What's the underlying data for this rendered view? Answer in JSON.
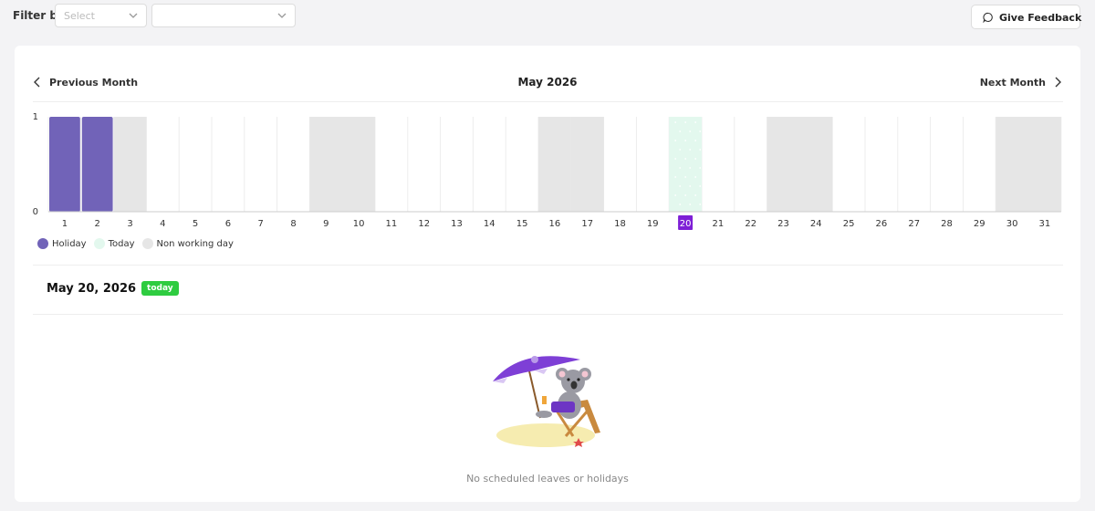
{
  "filter": {
    "label": "Filter by",
    "select1_placeholder": "Select",
    "select2_value": ""
  },
  "feedback": {
    "label": "Give Feedback",
    "icon": "chat-bubble-icon"
  },
  "nav": {
    "prev_label": "Previous Month",
    "next_label": "Next Month",
    "month_title": "May 2026"
  },
  "legend": [
    {
      "label": "Holiday",
      "color": "#7163b8"
    },
    {
      "label": "Today",
      "color": "#e3f8ee"
    },
    {
      "label": "Non working day",
      "color": "#e6e6e6"
    }
  ],
  "chart_data": {
    "type": "bar",
    "categories": [
      "1",
      "2",
      "3",
      "4",
      "5",
      "6",
      "7",
      "8",
      "9",
      "10",
      "11",
      "12",
      "13",
      "14",
      "15",
      "16",
      "17",
      "18",
      "19",
      "20",
      "21",
      "22",
      "23",
      "24",
      "25",
      "26",
      "27",
      "28",
      "29",
      "30",
      "31"
    ],
    "series": [
      {
        "name": "Holiday",
        "values": [
          1,
          1,
          0,
          0,
          0,
          0,
          0,
          0,
          0,
          0,
          0,
          0,
          0,
          0,
          0,
          0,
          0,
          0,
          0,
          0,
          0,
          0,
          0,
          0,
          0,
          0,
          0,
          0,
          0,
          0,
          0
        ]
      }
    ],
    "non_working_days": [
      3,
      9,
      10,
      16,
      17,
      23,
      24,
      30,
      31
    ],
    "today": 20,
    "yticks": [
      "0",
      "1"
    ],
    "ylim": [
      0,
      1
    ],
    "colors": {
      "holiday": "#7163b8",
      "non_working": "#e6e6e6",
      "today": "#e3f8ee",
      "today_label_bg": "#7e1fd6"
    }
  },
  "selected_date": {
    "date": "May 20, 2026",
    "badge": "today"
  },
  "empty_state": {
    "message": "No scheduled leaves or holidays",
    "illustration": "koala-beach-chair-umbrella-illustration"
  }
}
